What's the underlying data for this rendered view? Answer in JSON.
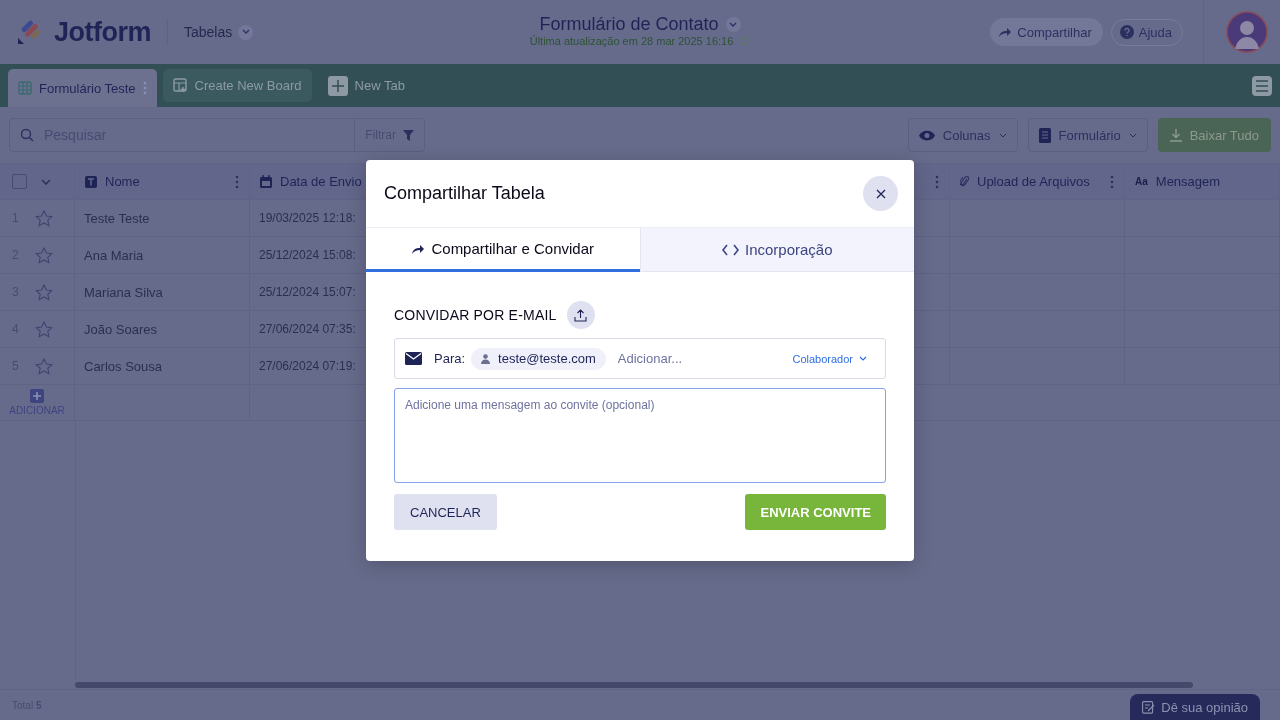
{
  "header": {
    "brand": "Jotform",
    "section": "Tabelas",
    "title": "Formulário de Contato",
    "subtitle": "Última atualização em 28 mar 2025 16:16",
    "share": "Compartilhar",
    "help": "Ajuda"
  },
  "tabs": [
    {
      "label": "Formulário Teste",
      "selected": true,
      "kind": "table"
    },
    {
      "label": "Create New Board",
      "selected": false,
      "kind": "board"
    },
    {
      "label": "New Tab",
      "selected": false,
      "kind": "add"
    }
  ],
  "toolbar": {
    "search_placeholder": "Pesquisar",
    "filter": "Filtrar",
    "columns": "Colunas",
    "form": "Formulário",
    "download": "Baixar Tudo"
  },
  "table": {
    "select_all_checked": false,
    "columns": [
      {
        "label": "Nome",
        "kind": "text"
      },
      {
        "label": "Data de Envio",
        "kind": "date"
      },
      {
        "kind": "hidden"
      },
      {
        "label": "Upload de Arquivos",
        "kind": "file"
      },
      {
        "label": "Mensagem",
        "kind": "textarea",
        "type_label": "Aa"
      }
    ],
    "rows": [
      {
        "number": "1",
        "starred": false,
        "name": "Teste Teste",
        "date": "19/03/2025 12:18:"
      },
      {
        "number": "2",
        "starred": false,
        "name": "Ana Maria",
        "date": "25/12/2024 15:08:"
      },
      {
        "number": "3",
        "starred": false,
        "name": "Mariana Silva",
        "date": "25/12/2024 15:07:"
      },
      {
        "number": "4",
        "starred": false,
        "name": "João Soares",
        "date": "27/06/2024 07:35:"
      },
      {
        "number": "5",
        "starred": false,
        "name": "Carlos Sousa",
        "date": "27/06/2024 07:19:"
      }
    ],
    "add": "ADICIONAR"
  },
  "status_bar": {
    "total_label": "Total",
    "total": "5",
    "feedback": "Dê sua opinião"
  },
  "dialog": {
    "title": "Compartilhar Tabela",
    "tabs": [
      {
        "label": "Compartilhar e Convidar",
        "selected": true,
        "kind": "share"
      },
      {
        "label": "Incorporação",
        "selected": false,
        "kind": "embed"
      }
    ],
    "section": "CONVIDAR POR E-MAIL",
    "to_label": "Para:",
    "recipient": "teste@teste.com",
    "add_placeholder": "Adicionar...",
    "role": "Colaborador",
    "message_placeholder": "Adicione uma mensagem ao convite (opcional)",
    "cancel": "CANCELAR",
    "send": "ENVIAR CONVITE"
  }
}
